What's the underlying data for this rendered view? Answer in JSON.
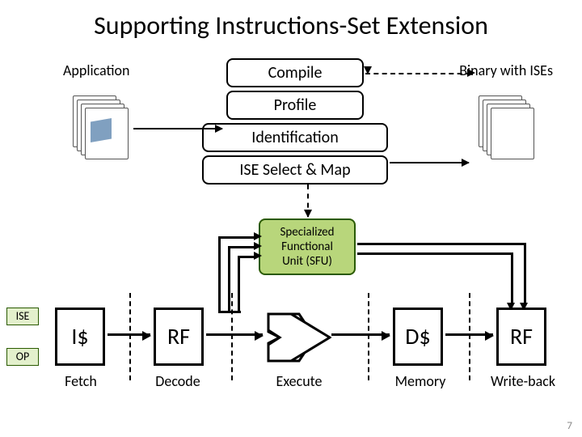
{
  "title": "Supporting Instructions-Set Extension",
  "row1": {
    "application_label": "Application",
    "binary_label": "Binary with ISEs",
    "steps": {
      "compile": "Compile",
      "profile": "Profile",
      "identification": "Identification",
      "ise_select_map": "ISE Select & Map"
    }
  },
  "sfu": {
    "line1": "Specialized",
    "line2": "Functional",
    "line3": "Unit (SFU)"
  },
  "pipeline": {
    "tags": {
      "ise": "ISE",
      "op": "OP"
    },
    "stages": {
      "icache": "I$",
      "rf1": "RF",
      "dcache": "D$",
      "rf2": "RF"
    },
    "labels": {
      "fetch": "Fetch",
      "decode": "Decode",
      "execute": "Execute",
      "memory": "Memory",
      "writeback": "Write-back"
    }
  },
  "slide_number": "7"
}
